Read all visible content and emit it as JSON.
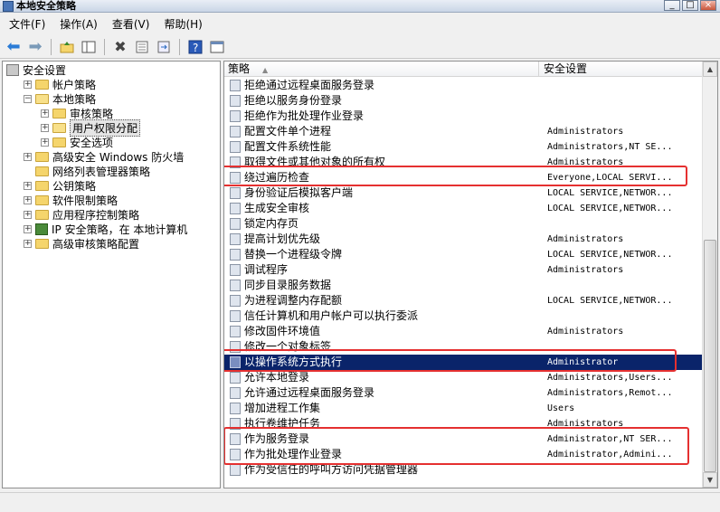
{
  "window": {
    "title": "本地安全策略"
  },
  "menu": [
    "文件(F)",
    "操作(A)",
    "查看(V)",
    "帮助(H)"
  ],
  "toolbar_icons": [
    "back-arrow-icon",
    "forward-arrow-icon",
    "up-folder-icon",
    "show-tree-icon",
    "delete-icon",
    "properties-icon",
    "export-icon",
    "help-icon",
    "show-console-icon"
  ],
  "tree": [
    {
      "label": "安全设置",
      "level": 0,
      "expander": "",
      "icon": "shield"
    },
    {
      "label": "帐户策略",
      "level": 1,
      "expander": "+",
      "icon": "folder"
    },
    {
      "label": "本地策略",
      "level": 1,
      "expander": "-",
      "icon": "folder-open"
    },
    {
      "label": "审核策略",
      "level": 2,
      "expander": "+",
      "icon": "folder"
    },
    {
      "label": "用户权限分配",
      "level": 2,
      "expander": "+",
      "icon": "folder-open",
      "selected": true
    },
    {
      "label": "安全选项",
      "level": 2,
      "expander": "+",
      "icon": "folder"
    },
    {
      "label": "高级安全 Windows 防火墙",
      "level": 1,
      "expander": "+",
      "icon": "folder"
    },
    {
      "label": "网络列表管理器策略",
      "level": 1,
      "expander": "",
      "icon": "folder"
    },
    {
      "label": "公钥策略",
      "level": 1,
      "expander": "+",
      "icon": "folder"
    },
    {
      "label": "软件限制策略",
      "level": 1,
      "expander": "+",
      "icon": "folder"
    },
    {
      "label": "应用程序控制策略",
      "level": 1,
      "expander": "+",
      "icon": "folder"
    },
    {
      "label": "IP 安全策略，在 本地计算机",
      "level": 1,
      "expander": "+",
      "icon": "ip"
    },
    {
      "label": "高级审核策略配置",
      "level": 1,
      "expander": "+",
      "icon": "folder"
    }
  ],
  "columns": {
    "policy": "策略",
    "setting": "安全设置"
  },
  "rows": [
    {
      "name": "拒绝通过远程桌面服务登录",
      "setting": ""
    },
    {
      "name": "拒绝以服务身份登录",
      "setting": ""
    },
    {
      "name": "拒绝作为批处理作业登录",
      "setting": ""
    },
    {
      "name": "配置文件单个进程",
      "setting": "Administrators"
    },
    {
      "name": "配置文件系统性能",
      "setting": "Administrators,NT SE..."
    },
    {
      "name": "取得文件或其他对象的所有权",
      "setting": "Administrators"
    },
    {
      "name": "绕过遍历检查",
      "setting": "Everyone,LOCAL SERVI..."
    },
    {
      "name": "身份验证后模拟客户端",
      "setting": "LOCAL SERVICE,NETWOR..."
    },
    {
      "name": "生成安全审核",
      "setting": "LOCAL SERVICE,NETWOR..."
    },
    {
      "name": "锁定内存页",
      "setting": ""
    },
    {
      "name": "提高计划优先级",
      "setting": "Administrators"
    },
    {
      "name": "替换一个进程级令牌",
      "setting": "LOCAL SERVICE,NETWOR..."
    },
    {
      "name": "调试程序",
      "setting": "Administrators"
    },
    {
      "name": "同步目录服务数据",
      "setting": ""
    },
    {
      "name": "为进程调整内存配额",
      "setting": "LOCAL SERVICE,NETWOR..."
    },
    {
      "name": "信任计算机和用户帐户可以执行委派",
      "setting": ""
    },
    {
      "name": "修改固件环境值",
      "setting": "Administrators"
    },
    {
      "name": "修改一个对象标签",
      "setting": ""
    },
    {
      "name": "以操作系统方式执行",
      "setting": "Administrator",
      "selected": true
    },
    {
      "name": "允许本地登录",
      "setting": "Administrators,Users..."
    },
    {
      "name": "允许通过远程桌面服务登录",
      "setting": "Administrators,Remot..."
    },
    {
      "name": "增加进程工作集",
      "setting": "Users"
    },
    {
      "name": "执行卷维护任务",
      "setting": "Administrators"
    },
    {
      "name": "作为服务登录",
      "setting": "Administrator,NT SER..."
    },
    {
      "name": "作为批处理作业登录",
      "setting": "Administrator,Admini..."
    },
    {
      "name": "作为受信任的呼叫方访问凭据管理器",
      "setting": ""
    }
  ]
}
